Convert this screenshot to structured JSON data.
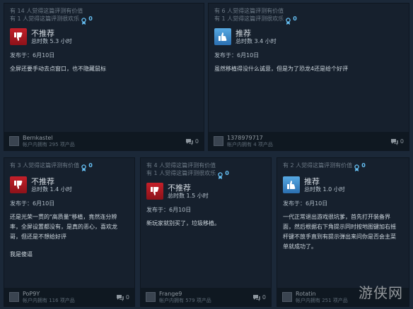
{
  "reviews": [
    {
      "helpful": "有 14 人觉得这篇评测有价值",
      "funny": "有 1 人觉得这篇评测很欢乐",
      "awards": "0",
      "verdict": "不推荐",
      "recommended": false,
      "hours": "总时数 5.3 小时",
      "posted": "发布于：6月10日",
      "lines": [
        "全屏还要手动去点窗口，也不隐藏鼠标"
      ],
      "username": "Bernkastel",
      "products": "帐户内拥有 295 项产品",
      "comments": "0"
    },
    {
      "helpful": "有 6 人觉得这篇评测有价值",
      "funny": "有 1 人觉得这篇评测很欢乐",
      "awards": "0",
      "verdict": "推荐",
      "recommended": true,
      "hours": "总时数 3.4 小时",
      "posted": "发布于：6月10日",
      "lines": [
        "虽然移植得没什么诚意，但是为了恐龙4还是给个好评"
      ],
      "username": "1378979717",
      "products": "帐户内拥有 4 项产品",
      "comments": "0"
    },
    {
      "helpful": "有 3 人觉得这篇评测有价值",
      "funny": "",
      "awards": "0",
      "verdict": "不推荐",
      "recommended": false,
      "hours": "总时数 1.4 小时",
      "posted": "发布于：6月10日",
      "lines": [
        "还是光荣一贯的\"高质量\"移植，竟然连分辨",
        "率，全屏设置都没有，是真的恶心，喜欢龙",
        "哥，但还是不想给好评",
        "",
        "我是傻逼"
      ],
      "username": "PoP9Y",
      "products": "帐户内拥有 116 项产品",
      "comments": "0"
    },
    {
      "helpful": "有 4 人觉得这篇评测有价值",
      "funny": "有 1 人觉得这篇评测很欢乐",
      "awards": "0",
      "verdict": "不推荐",
      "recommended": false,
      "hours": "总时数 1.5 小时",
      "posted": "发布于：6月10日",
      "lines": [
        "新玩家就别买了，垃圾移植。"
      ],
      "username": "Frange9",
      "products": "帐户内拥有 579 项产品",
      "comments": "0"
    },
    {
      "helpful": "有 2 人觉得这篇评测有价值",
      "funny": "",
      "awards": "0",
      "verdict": "推荐",
      "recommended": true,
      "hours": "总时数 1.0 小时",
      "posted": "发布于：6月10日",
      "lines": [
        "一代正常退出游戏很坑爹，首先打开装备界",
        "面，然后根据右下角提示同时按地图键加右摇",
        "杆键不放手直到有提示弹出来问你是否会主菜",
        "单就成功了。"
      ],
      "username": "Rotatin",
      "products": "帐户内拥有 251 项产品",
      "comments": "0"
    }
  ],
  "watermark": "游侠网"
}
